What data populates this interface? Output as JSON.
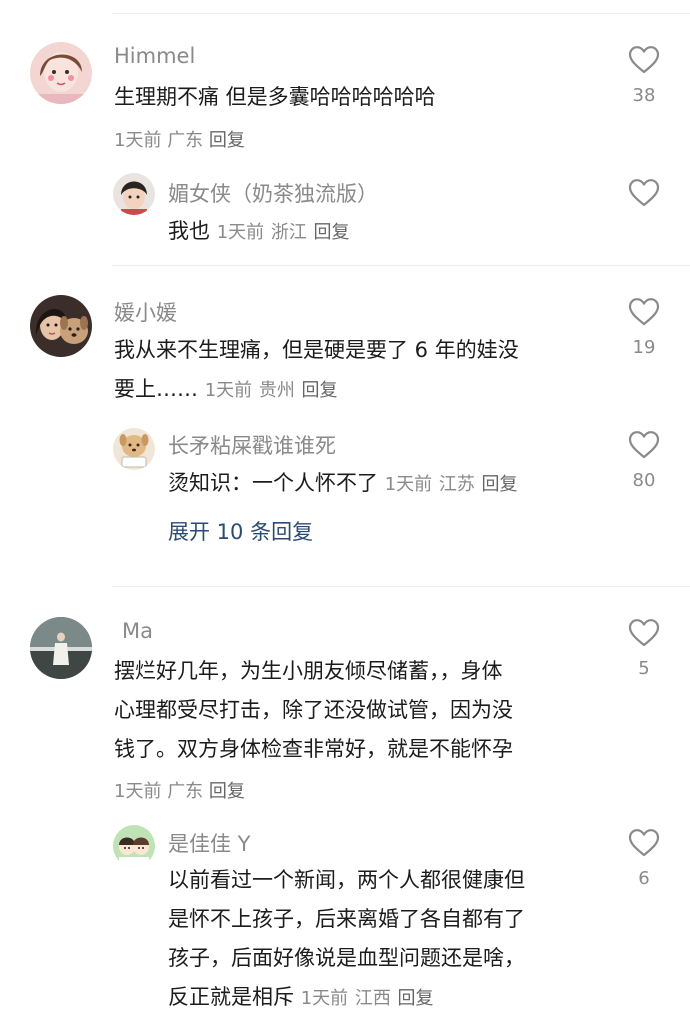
{
  "comments": [
    {
      "username": "Himmel",
      "text": "生理期不痛 但是多囊哈哈哈哈哈哈",
      "time": "1天前",
      "location": "广东",
      "reply_label": "回复",
      "likes": "38",
      "avatar_icon": "girl-selfie-avatar",
      "reply": {
        "username": "媚女侠（奶茶独流版）",
        "text": "我也",
        "time": "1天前",
        "location": "浙江",
        "reply_label": "回复",
        "likes": "",
        "avatar_icon": "child-avatar"
      }
    },
    {
      "username": "媛小媛",
      "text_line1": "我从来不生理痛，但是硬是要了 6 年的娃没",
      "text_line2": "要上……",
      "time": "1天前",
      "location": "贵州",
      "reply_label": "回复",
      "likes": "19",
      "avatar_icon": "girl-with-dog-avatar",
      "reply": {
        "username": "长矛粘屎戳谁谁死",
        "text": "烫知识：一个人怀不了",
        "time": "1天前",
        "location": "江苏",
        "reply_label": "回复",
        "likes": "80",
        "avatar_icon": "dog-meme-avatar"
      },
      "expand_label": "展开 10 条回复"
    },
    {
      "username": "Ma",
      "text_line1": "摆烂好几年，为生小朋友倾尽储蓄，，身体",
      "text_line2": "心理都受尽打击，除了还没做试管，因为没",
      "text_line3": "钱了。双方身体检查非常好，就是不能怀孕",
      "time": "1天前",
      "location": "广东",
      "reply_label": "回复",
      "likes": "5",
      "avatar_icon": "landscape-person-avatar",
      "reply": {
        "username": "是佳佳 Y",
        "text_line1": "以前看过一个新闻，两个人都很健康但",
        "text_line2": "是怀不上孩子，后来离婚了各自都有了",
        "text_line3": "孩子，后面好像说是血型问题还是啥，",
        "text_line4": "反正就是相斥",
        "time": "1天前",
        "location": "江西",
        "reply_label": "回复",
        "likes": "6",
        "avatar_icon": "cartoon-couple-avatar"
      }
    }
  ],
  "colors": {
    "meta": "#8a8a8a",
    "text": "#1c1c1c",
    "link": "#2c4b73",
    "heart": "#8a8a8a"
  }
}
